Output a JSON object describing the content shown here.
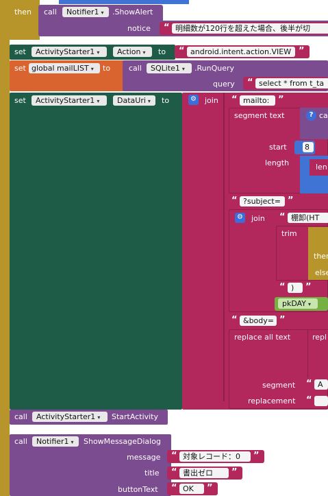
{
  "colors": {
    "control": "#b8952b",
    "text": "#b3285c",
    "components": "#1f5c47",
    "procedures_purple": "#7b4c8f",
    "variables": "#d96430",
    "math": "#3f74d4",
    "field_bg": "#e9e9e9"
  },
  "blocks": {
    "then_label": "then",
    "call": "call",
    "set": "set",
    "to": "to",
    "notifier1": "Notifier1",
    "show_alert": ".ShowAlert",
    "notice": "notice",
    "notice_text": "明細数が120行を超えた場合、後半が切",
    "activity_starter1": "ActivityStarter1",
    "action_prop": "Action",
    "action_value": "android.intent.action.VIEW",
    "global_mail_list": "global mailLIST",
    "sqlite1": "SQLite1",
    "run_query": ".RunQuery",
    "query": "query",
    "query_text": "select * from t_ta",
    "data_uri_prop": "DataUri",
    "join": "join",
    "mailto": "mailto:",
    "segment_text": "segment  text",
    "start": "start",
    "start_value": "8",
    "length": "length",
    "length_partial": "len",
    "subject": "?subject=",
    "tanaoroshi": "棚卸(HT",
    "trim": "trim",
    "then_partial": "then",
    "else_partial": "else",
    "close_paren": ")",
    "pkday": "pkDAY",
    "body": "&body=",
    "replace_all_text": "replace all  text",
    "repl_partial": "repl",
    "segment": "segment",
    "seg_partial": "A",
    "replacement": "replacement",
    "start_activity": "StartActivity",
    "show_message_dialog": "ShowMessageDialog",
    "message": "message",
    "message_text": "対象レコード：0",
    "title": "title",
    "title_text": "書出ゼロ",
    "button_text": "buttonText",
    "button_text_value": "OK",
    "quote_open": "“",
    "quote_close": "”",
    "dropdown": "▾",
    "gear": "⚙",
    "question": "?"
  }
}
